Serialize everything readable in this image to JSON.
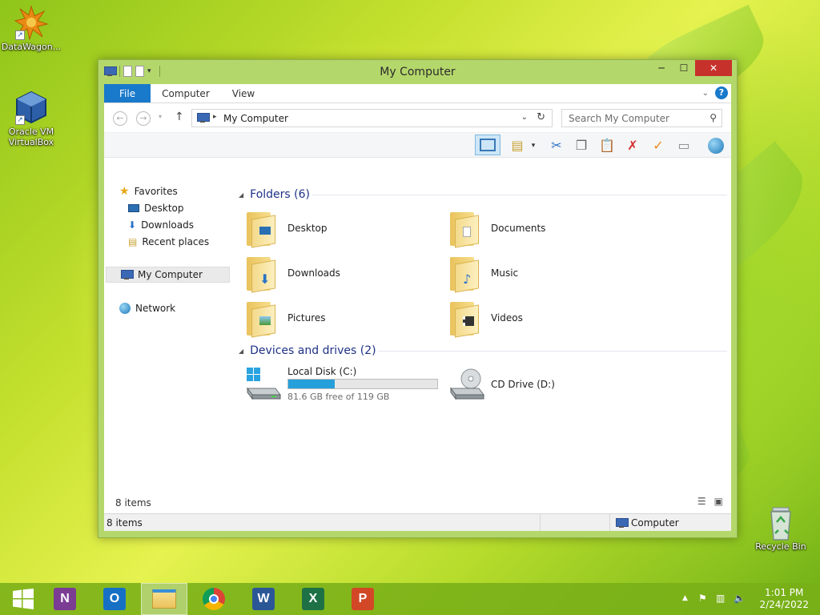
{
  "desktop": {
    "icons": [
      {
        "label": "DataWagon..."
      },
      {
        "label": "Oracle VM VirtualBox"
      },
      {
        "label": "Recycle Bin"
      }
    ]
  },
  "window": {
    "title": "My Computer",
    "ribbon_tabs": [
      "File",
      "Computer",
      "View"
    ],
    "address": "My Computer",
    "search_placeholder": "Search My Computer",
    "nav": {
      "favorites": "Favorites",
      "favorites_items": [
        "Desktop",
        "Downloads",
        "Recent places"
      ],
      "my_computer": "My Computer",
      "network": "Network"
    },
    "groups": {
      "folders_header": "Folders (6)",
      "folders": [
        "Desktop",
        "Documents",
        "Downloads",
        "Music",
        "Pictures",
        "Videos"
      ],
      "devices_header": "Devices and drives (2)",
      "drives": [
        {
          "name": "Local Disk (C:)",
          "free_text": "81.6 GB free of 119 GB",
          "used_fraction": 0.314
        },
        {
          "name": "CD Drive (D:)"
        }
      ]
    },
    "items_count": "8 items",
    "status": {
      "left": "8 items",
      "location": "Computer"
    }
  },
  "taskbar": {
    "time": "1:01 PM",
    "date": "2/24/2022",
    "apps": [
      "onenote",
      "outlook",
      "file-explorer",
      "chrome",
      "word",
      "excel",
      "powerpoint"
    ]
  },
  "colors": {
    "accent": "#1979ca",
    "drive_fill": "#26a0da",
    "close": "#c7312b"
  }
}
